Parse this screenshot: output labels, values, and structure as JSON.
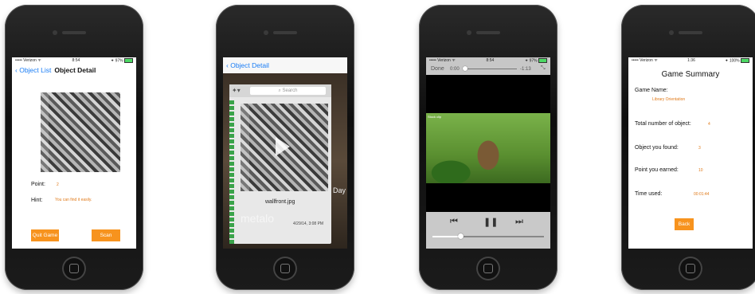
{
  "phone1": {
    "carrier": "••••• Verizon ᯤ",
    "time": "8:54",
    "battery": "✦ 97%",
    "back_label": "Object List",
    "title": "Object Detail",
    "point_label": "Point:",
    "point_value": "2",
    "hint_label": "Hint:",
    "hint_value": "You can find it easily.",
    "quit_button": "Quit Game",
    "scan_button": "Scan"
  },
  "phone2": {
    "back_label": "Object Detail",
    "search_placeholder": "Search",
    "file_name": "wallfront.jpg",
    "watermark": "metalo",
    "file_meta": "4/29/14, 3:08 PM",
    "side_text": "Day",
    "dropbox_icon": "dropbox-icon",
    "play_icon": "play-icon"
  },
  "phone3": {
    "carrier": "••••• Verizon ᯤ",
    "time": "8:54",
    "battery": "✦ 97%",
    "done_label": "Done",
    "elapsed": "0:00",
    "remaining": "-1:13",
    "corner_label": "Stock clip",
    "rewind_icon": "rewind-icon",
    "pause_icon": "pause-icon",
    "forward_icon": "fast-forward-icon",
    "scrub_progress": 0.02,
    "volume_level": 0.25
  },
  "phone4": {
    "carrier": "••••• Verizon ᯤ",
    "time": "1:36",
    "battery": "✦ 100%",
    "title": "Game Summary",
    "game_name_label": "Game Name:",
    "game_name_value": "Library Orientation",
    "total_label": "Total number of object:",
    "total_value": "4",
    "found_label": "Object you found:",
    "found_value": "3",
    "earned_label": "Point you earned:",
    "earned_value": "10",
    "time_label": "Time used:",
    "time_value": "00:01:44",
    "back_button": "Back"
  }
}
